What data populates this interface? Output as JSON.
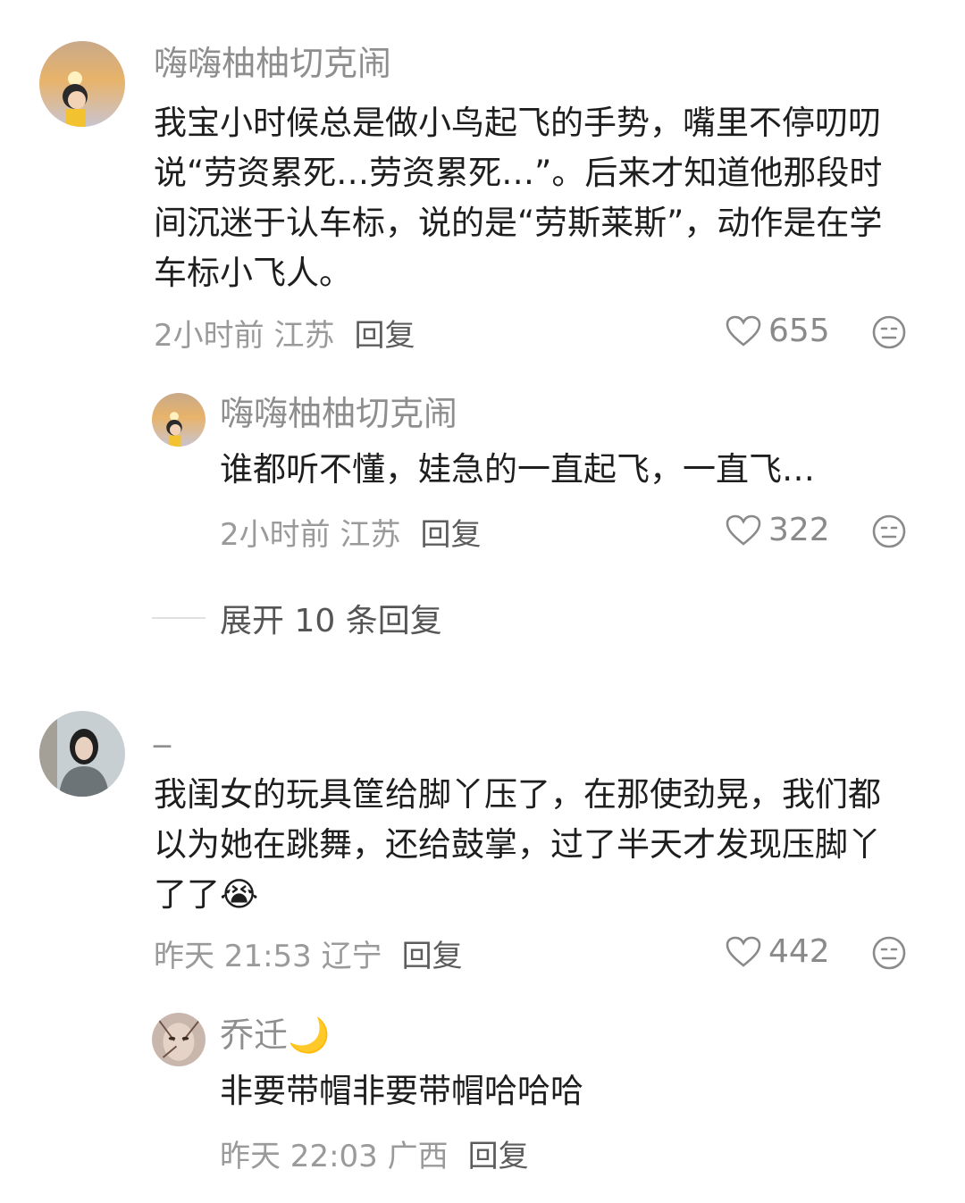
{
  "comments": [
    {
      "user": "嗨嗨柚柚切克闹",
      "text": "我宝小时候总是做小鸟起飞的手势，嘴里不停叨叨说“劳资累死…劳资累死…”。后来才知道他那段时间沉迷于认车标，说的是“劳斯莱斯”，动作是在学车标小飞人。",
      "time": "2小时前 江苏",
      "reply_label": "回复",
      "likes": "655",
      "replies": [
        {
          "user": "嗨嗨柚柚切克闹",
          "text": "谁都听不懂，娃急的一直起飞，一直飞…",
          "time": "2小时前 江苏",
          "reply_label": "回复",
          "likes": "322"
        }
      ],
      "expand_label": "展开 10 条回复"
    },
    {
      "user": "_",
      "text": "我闺女的玩具筐给脚丫压了，在那使劲晃，我们都以为她在跳舞，还给鼓掌，过了半天才发现压脚丫了了😭",
      "time": "昨天 21:53 辽宁",
      "reply_label": "回复",
      "likes": "442",
      "replies": [
        {
          "user": "乔迁🌙",
          "text": "非要带帽非要带帽哈哈哈",
          "time": "昨天 22:03 广西",
          "reply_label": "回复"
        }
      ]
    }
  ],
  "icons": {
    "like": "heart-outline-icon",
    "dislike": "meh-face-icon"
  },
  "colors": {
    "username": "#8e8e8e",
    "meta": "#9a9a9a",
    "text": "#1e1e1e"
  }
}
